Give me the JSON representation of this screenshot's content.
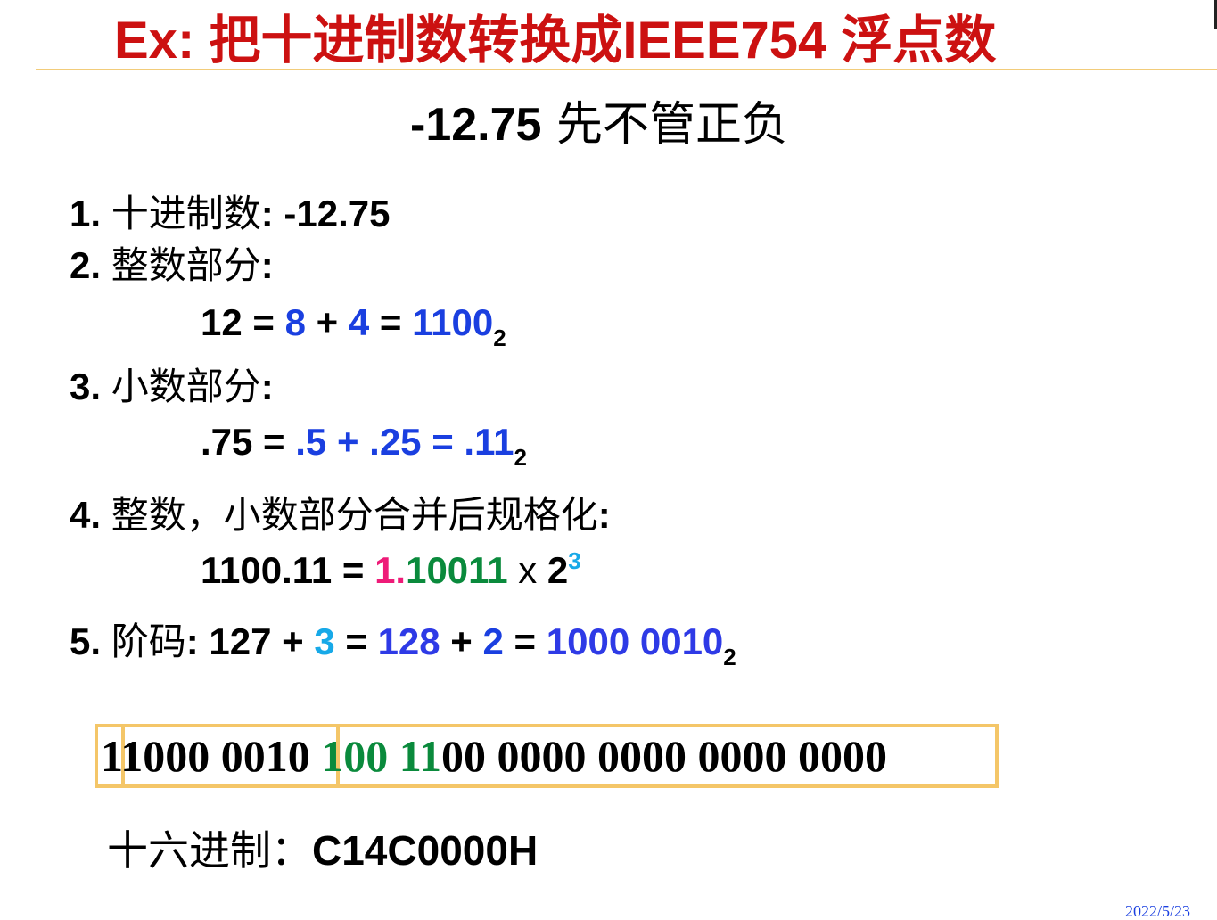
{
  "title": "Ex: 把十进制数转换成IEEE754 浮点数",
  "subtitle": {
    "num": "-12.75",
    "text": " 先不管正负"
  },
  "steps": {
    "s1": {
      "no": "1. ",
      "label": "十进制数",
      "colon": ":",
      "value": " -12.75"
    },
    "s2": {
      "no": "2. ",
      "label": "整数部分",
      "colon": ":"
    },
    "s2eq": {
      "a": "12 = ",
      "b": "8",
      "c": " + ",
      "d": "4",
      "e": " = ",
      "f": "1100",
      "sub": "2"
    },
    "s3": {
      "no": "3. ",
      "label": "小数部分",
      "colon": ":"
    },
    "s3eq": {
      "a": ".75 = ",
      "b": ".5 + .25 = .11",
      "sub": "2"
    },
    "s4": {
      "no": "4. ",
      "label": "整数，小数部分合并后规格化",
      "colon": ":"
    },
    "s4eq": {
      "a": "1100.11 = ",
      "b": "1.",
      "c": "10011",
      "d": " x ",
      "e": "2",
      "sup": "3"
    },
    "s5": {
      "no": "5. ",
      "label": "阶码",
      "a": ": 127 + ",
      "b": "3",
      "c": " = ",
      "d": "128",
      "e": " + ",
      "f": "2",
      "g": " = ",
      "h": "1000 0010",
      "sub": "2"
    }
  },
  "binary": {
    "sign": "1",
    "exponent": "1000 0010 ",
    "mant_green": "100 11",
    "mant_rest": "00 0000 0000 0000 0000"
  },
  "hex": {
    "label": "十六进制：",
    "value": "C14C0000H"
  },
  "date": "2022/5/23"
}
